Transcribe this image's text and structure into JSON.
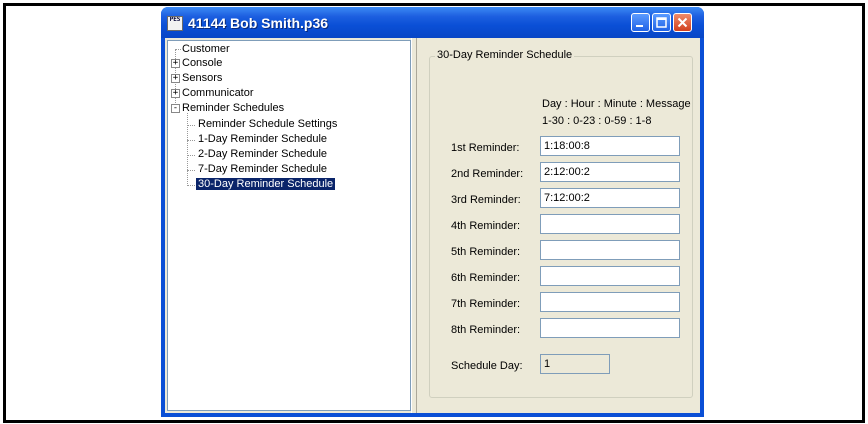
{
  "window": {
    "title": "41144 Bob Smith.p36",
    "icon_text": "PES"
  },
  "tree": {
    "items": [
      {
        "label": "Customer",
        "expander": ""
      },
      {
        "label": "Console",
        "expander": "+"
      },
      {
        "label": "Sensors",
        "expander": "+"
      },
      {
        "label": "Communicator",
        "expander": "+"
      },
      {
        "label": "Reminder Schedules",
        "expander": "-"
      },
      {
        "label": "Reminder Schedule Settings",
        "expander": ""
      },
      {
        "label": "1-Day Reminder Schedule",
        "expander": ""
      },
      {
        "label": "2-Day Reminder Schedule",
        "expander": ""
      },
      {
        "label": "7-Day Reminder Schedule",
        "expander": ""
      },
      {
        "label": "30-Day Reminder Schedule",
        "expander": "",
        "selected": true
      }
    ]
  },
  "schedule": {
    "group_title": "30-Day Reminder Schedule",
    "header_line1": "Day : Hour : Minute : Message",
    "header_line2": "1-30 : 0-23  :  0-59   : 1-8",
    "reminders": [
      {
        "label": "1st Reminder:",
        "value": "1:18:00:8"
      },
      {
        "label": "2nd Reminder:",
        "value": "2:12:00:2"
      },
      {
        "label": "3rd Reminder:",
        "value": "7:12:00:2"
      },
      {
        "label": "4th Reminder:",
        "value": ""
      },
      {
        "label": "5th Reminder:",
        "value": ""
      },
      {
        "label": "6th Reminder:",
        "value": ""
      },
      {
        "label": "7th Reminder:",
        "value": ""
      },
      {
        "label": "8th Reminder:",
        "value": ""
      }
    ],
    "schedule_day_label": "Schedule Day:",
    "schedule_day_value": "1"
  },
  "colors": {
    "titlebar": "#0a4fd6",
    "selection": "#0a246a",
    "client_bg": "#ece9d8",
    "close_button": "#d1401e"
  }
}
